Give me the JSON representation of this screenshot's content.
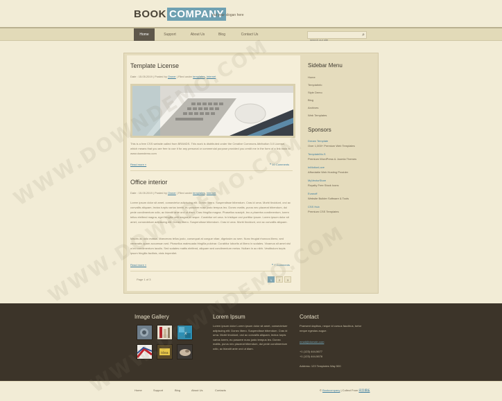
{
  "header": {
    "logo_book": "BOOK",
    "logo_company": "COMPANY",
    "slogan": "put your slogan here"
  },
  "nav": {
    "items": [
      "Home",
      "Support",
      "About Us",
      "Blog",
      "Contact Us"
    ],
    "active_index": 0,
    "search_placeholder": "search our site"
  },
  "posts": [
    {
      "title": "Template License",
      "meta_prefix": "Date : 15.05.2019  |  Posted by",
      "meta_author": "Owner",
      "meta_mid": "|  Filed under",
      "meta_cat1": "templates",
      "meta_cat2": "Internet",
      "text": "This is a free CSS website called from BRANDS. This work is distributed under the Creative Commons Attribution 3.0 License, which means that you are free to use it for any personal or commercial purpose provided you credit me in the form of a link back to www.downdemo.com",
      "read_more": "Read more »",
      "comments": "10  Comments"
    },
    {
      "title": "Office interior",
      "meta_prefix": "Date : 15.05.2019  |  Posted by",
      "meta_author": "Owner",
      "meta_mid": "|  Filed under",
      "meta_cat1": "templates",
      "meta_cat2": "Internet",
      "text1": "Lorem ipsum dolor sit amet, consectetur adipiscing elit. Donec libero. Suspendisse bibendum. Cras id urna. Morbi tincidunt, orci ac convallis aliquam, lectus turpis varius lorem, eu posuere nunc justo tempus leo. Donec mattis, purus nec placerat bibendum, dui pede condimentum odio, ac blandit ante orci ut diam. Cras fringilla magna. Phasellus suscipit, leo a pharetra condimentum, lorem tellus eleifend magna, eget fringilla velit magna id neque. Curabitur vel urna. In tristique orci porttitor ipsum. Lorem ipsum dolor sit amet, consectetuer adipiscing elit. Donec libero. Suspendisse bibendum. Cras id urna. Morbi tincidunt, orci ac convallis aliquam.",
      "text2": "Mauris ac odio massa. Maecenas tellus justo, consequat at congue vitae, dignissim ac sem. Nunc feugiat rhoncus libero, sed venenatis quam accumsan sed. Phasellus malesuada fringilla pulvinar. Curabitur lobortis ut libero in sodales. Vivamus sit amet nisl a leo condimentum iaculis. Sed sodales mattis eleifend, aliquam sed condimentum metus. Nullam in ac nibh. Vestibulum turpis ipsum fringilla facilisis, nisis imperdiet.",
      "read_more": "Read more »",
      "comments": "7  Comments"
    }
  ],
  "pagination": {
    "text": "Page 1 of 3",
    "pages": [
      "1",
      "2",
      "3"
    ],
    "active": 0
  },
  "sidebar": {
    "menu_title": "Sidebar Menu",
    "menu_items": [
      "Home",
      "Templatinfo",
      "Style Demo",
      "Blog",
      "Archives",
      "Web Templates"
    ],
    "sponsors_title": "Sponsors",
    "sponsors": [
      {
        "name": "Dream Template",
        "desc": "Over 1,000+ Premium Web Templates"
      },
      {
        "name": "TemplateMo.S",
        "desc": "Premium WordPress & Joomla Themes"
      },
      {
        "name": "InMotionLove",
        "desc": "Affordable Web Hosting Provider"
      },
      {
        "name": "MyVectorStore",
        "desc": "Royalty Free Stock Icons"
      },
      {
        "name": "Evanoff",
        "desc": "Website Builder Software & Tools"
      },
      {
        "name": "CSS Hub",
        "desc": "Premium CSS Templates"
      }
    ]
  },
  "footer": {
    "gallery_title": "Image Gallery",
    "lorem_title": "Lorem Ipsum",
    "lorem_text": "Lorem ipsum dolor Lorem ipsum dolor sit amet, consectetuer adipiscing elit. Donec libero. Suspendisse bibendum. Cras id urna. Morbi tincidunt, orci ac convallis aliquam, lectus turpis varius lorem, eu posuere nunc justo tempus leo. Donec mattis, purus nec placerat bibendum, dui pede condimentum odio, ac blandit ante orci ut diam.",
    "contact_title": "Contact",
    "contact_text": "Praesent dapibus, neque id cursus faucibus, tortor neque egestas augue.",
    "contact_email": "email@domain.com",
    "phone1": "+1 (123) 444-5677",
    "phone2": "+1 (123) 444-5678",
    "address": "Address: 123 Templates Way 500"
  },
  "bottom": {
    "links": [
      "Home",
      "Support",
      "Blog",
      "About Us",
      "Contacts"
    ],
    "copyright_prefix": "© ",
    "copyright_link1": "Bookcompany",
    "copyright_mid": " | Collect From ",
    "copyright_link2": "网页模板"
  },
  "watermark": "WWW.DOWNDEMO.COM",
  "colors": {
    "background": "#f2ecd6",
    "nav_active": "#5e574a",
    "accent": "#6fa1b2",
    "footer": "#3c3429",
    "link": "#3f7fa0"
  }
}
